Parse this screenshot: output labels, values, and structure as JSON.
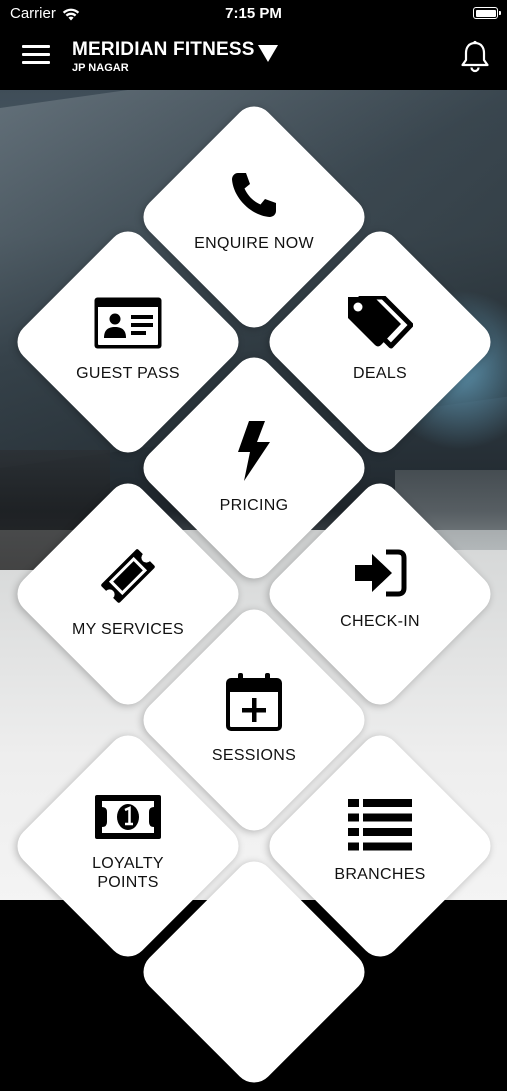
{
  "status_bar": {
    "carrier": "Carrier",
    "time": "7:15 PM"
  },
  "header": {
    "title": "MERIDIAN FITNESS",
    "subtitle": "JP NAGAR"
  },
  "tiles": [
    {
      "label": "ENQUIRE NOW",
      "icon": "phone-icon"
    },
    {
      "label": "GUEST PASS",
      "icon": "id-card-icon"
    },
    {
      "label": "DEALS",
      "icon": "tags-icon"
    },
    {
      "label": "PRICING",
      "icon": "lightning-bolt-icon"
    },
    {
      "label": "MY SERVICES",
      "icon": "ticket-icon"
    },
    {
      "label": "CHECK-IN",
      "icon": "sign-in-icon"
    },
    {
      "label": "SESSIONS",
      "icon": "calendar-plus-icon"
    },
    {
      "label": "LOYALTY POINTS",
      "icon": "money-bill-icon"
    },
    {
      "label": "BRANCHES",
      "icon": "list-icon"
    }
  ]
}
